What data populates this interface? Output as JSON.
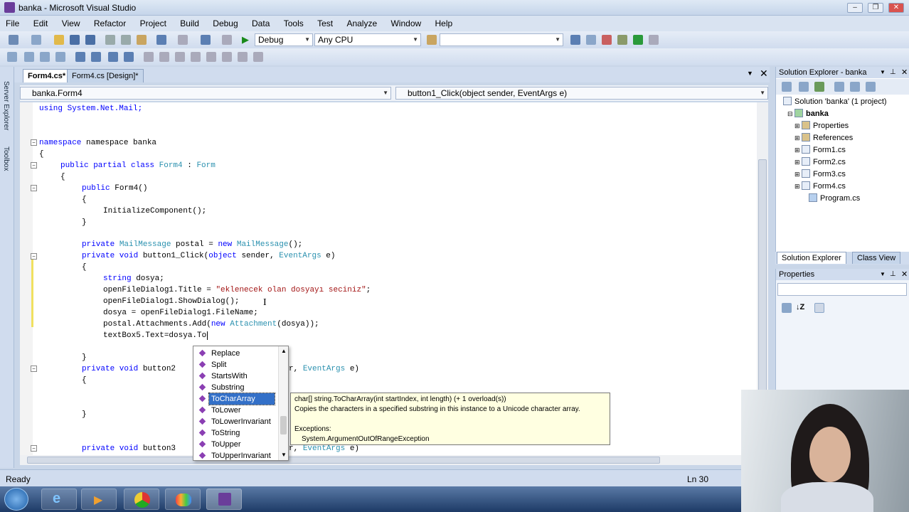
{
  "window": {
    "title": "banka - Microsoft Visual Studio"
  },
  "menu": [
    "File",
    "Edit",
    "View",
    "Refactor",
    "Project",
    "Build",
    "Debug",
    "Data",
    "Tools",
    "Test",
    "Analyze",
    "Window",
    "Help"
  ],
  "toolbar": {
    "config": "Debug",
    "platform": "Any CPU"
  },
  "tabs": [
    {
      "label": "Form4.cs*",
      "active": true
    },
    {
      "label": "Form4.cs [Design]*",
      "active": false
    }
  ],
  "left_strip": {
    "server_explorer": "Server Explorer",
    "toolbox": "Toolbox"
  },
  "nav": {
    "class_combo": "banka.Form4",
    "member_combo": "button1_Click(object sender, EventArgs e)"
  },
  "code": {
    "l1": "using System.Net.Mail;",
    "l2": "namespace banka",
    "l3": "{",
    "l4a": "public partial class ",
    "l4b": "Form4",
    "l4c": " : ",
    "l4d": "Form",
    "l5": "{",
    "l6a": "public ",
    "l6b": "Form4()",
    "l7": "{",
    "l8": "InitializeComponent();",
    "l9": "}",
    "l10a": "private ",
    "l10b": "MailMessage",
    "l10c": " postal = ",
    "l10d": "new ",
    "l10e": "MailMessage",
    "l10f": "();",
    "l11a": "private void ",
    "l11b": "button1_Click(",
    "l11c": "object",
    "l11d": " sender, ",
    "l11e": "EventArgs",
    "l11f": " e)",
    "l12": "{",
    "l13a": "string",
    "l13b": " dosya;",
    "l14a": "openFileDialog1.Title = ",
    "l14b": "\"eklenecek olan dosyayı seciniz\"",
    "l14c": ";",
    "l15": "openFileDialog1.ShowDialog();",
    "l16": "dosya = openFileDialog1.FileName;",
    "l17a": "postal.Attachments.Add(",
    "l17b": "new ",
    "l17c": "Attachment",
    "l17d": "(dosya));",
    "l18": "textBox5.Text=dosya.To",
    "l19": "}",
    "l20a": "private void ",
    "l20b": "button2",
    "l20c": "r, ",
    "l20d": "EventArgs",
    "l20e": " e)",
    "l21": "{",
    "l22": "}",
    "l23a": "private void ",
    "l23b": "button3",
    "l23c": "r, ",
    "l23d": "EventArgs",
    "l23e": " e)"
  },
  "intellisense": {
    "items": [
      "Replace",
      "Split",
      "StartsWith",
      "Substring",
      "ToCharArray",
      "ToLower",
      "ToLowerInvariant",
      "ToString",
      "ToUpper",
      "ToUpperInvariant"
    ],
    "selected": "ToCharArray"
  },
  "tooltip": {
    "signature": "char[] string.ToCharArray(int startIndex, int length)  (+ 1 overload(s))",
    "description": "Copies the characters in a specified substring in this instance to a Unicode character array.",
    "exceptions_label": "Exceptions:",
    "exception": "System.ArgumentOutOfRangeException"
  },
  "solution_explorer": {
    "title": "Solution Explorer - banka",
    "solution": "Solution 'banka' (1 project)",
    "project": "banka",
    "items": [
      "Properties",
      "References",
      "Form1.cs",
      "Form2.cs",
      "Form3.cs",
      "Form4.cs",
      "Program.cs"
    ],
    "tab_se": "Solution Explorer",
    "tab_cv": "Class View"
  },
  "properties": {
    "title": "Properties"
  },
  "status": {
    "left": "Ready",
    "right": "Ln 30"
  },
  "colors": {
    "keyword": "#0000ff",
    "type": "#2b91af",
    "string": "#a31515",
    "selection": "#3370c8"
  }
}
